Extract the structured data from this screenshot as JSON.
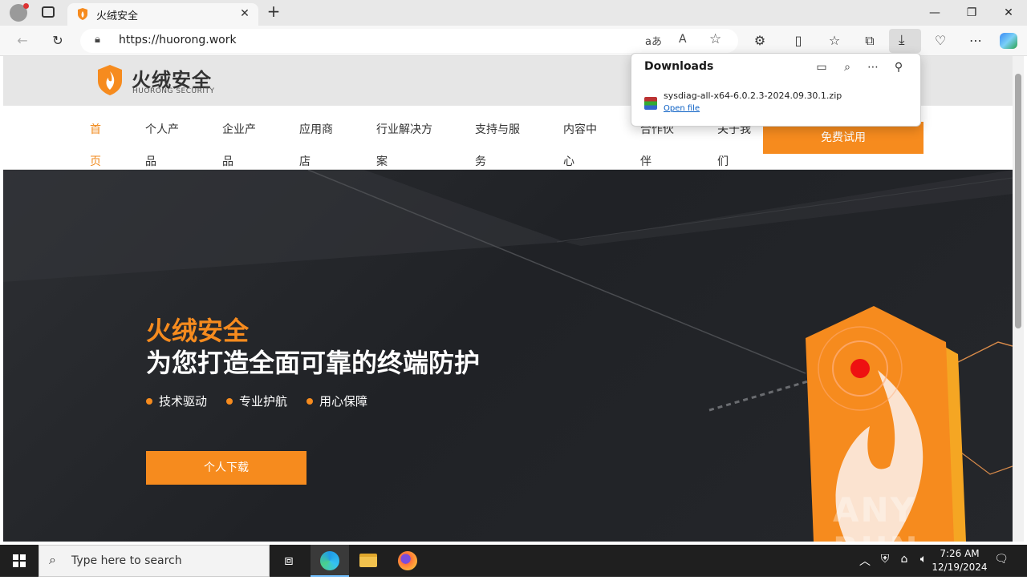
{
  "browser": {
    "tab_title": "火绒安全",
    "url": "https://huorong.work",
    "window_controls": {
      "minimize": "—",
      "maximize": "❐",
      "close": "✕"
    }
  },
  "downloads": {
    "title": "Downloads",
    "file_name": "sysdiag-all-x64-6.0.2.3-2024.09.30.1.zip",
    "open_file_label": "Open file"
  },
  "site": {
    "logo_cn": "火绒安全",
    "logo_en": "HUORONG SECURITY",
    "nav": [
      "首页",
      "个人产品",
      "企业产品",
      "应用商店",
      "行业解决方案",
      "支持与服务",
      "内容中心",
      "合作伙伴",
      "关于我们"
    ],
    "trial_button": "免费试用",
    "hero": {
      "title1": "火绒安全",
      "title2": "为您打造全面可靠的终端防护",
      "bullets": [
        "技术驱动",
        "专业护航",
        "用心保障"
      ],
      "download_button": "个人下载"
    },
    "watermark": "ANY RUN"
  },
  "taskbar": {
    "search_placeholder": "Type here to search",
    "time": "7:26 AM",
    "date": "12/19/2024"
  },
  "colors": {
    "accent": "#f68b1e",
    "hero_bg": "#25272b"
  }
}
